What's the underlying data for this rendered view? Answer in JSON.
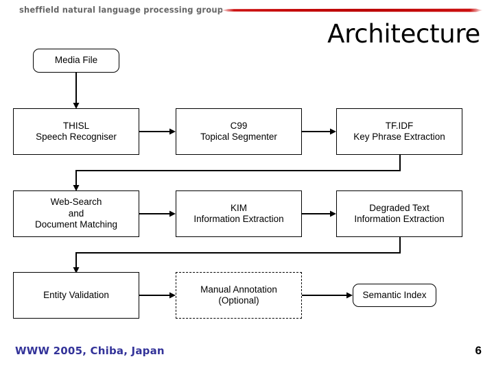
{
  "slide": {
    "header_logo": "sheffield natural language processing group",
    "title": "Architecture",
    "accent_color": "#cc1111",
    "footer_conference": "WWW 2005, Chiba, Japan",
    "footer_conference_color": "#333399",
    "page_number": "6"
  },
  "diagram": {
    "nodes": [
      {
        "id": "media-file",
        "label": "Media File",
        "shape": "rounded"
      },
      {
        "id": "thisl",
        "label": "THISL\nSpeech Recogniser",
        "shape": "rect"
      },
      {
        "id": "c99",
        "label": "C99\nTopical Segmenter",
        "shape": "rect"
      },
      {
        "id": "tfidf",
        "label": "TF.IDF\nKey Phrase Extraction",
        "shape": "rect"
      },
      {
        "id": "web-search",
        "label": "Web-Search\nand\nDocument Matching",
        "shape": "rect"
      },
      {
        "id": "kim",
        "label": "KIM\nInformation Extraction",
        "shape": "rect"
      },
      {
        "id": "degraded-text",
        "label": "Degraded Text\nInformation Extraction",
        "shape": "rect"
      },
      {
        "id": "entity-validation",
        "label": "Entity Validation",
        "shape": "rect"
      },
      {
        "id": "manual-annotation",
        "label": "Manual Annotation\n(Optional)",
        "shape": "dashed"
      },
      {
        "id": "semantic-index",
        "label": "Semantic Index",
        "shape": "rounded"
      }
    ],
    "edges": [
      {
        "from": "media-file",
        "to": "thisl"
      },
      {
        "from": "thisl",
        "to": "c99"
      },
      {
        "from": "c99",
        "to": "tfidf"
      },
      {
        "from": "tfidf",
        "to": "web-search"
      },
      {
        "from": "web-search",
        "to": "kim"
      },
      {
        "from": "kim",
        "to": "degraded-text"
      },
      {
        "from": "degraded-text",
        "to": "entity-validation"
      },
      {
        "from": "entity-validation",
        "to": "manual-annotation"
      },
      {
        "from": "manual-annotation",
        "to": "semantic-index"
      }
    ]
  }
}
